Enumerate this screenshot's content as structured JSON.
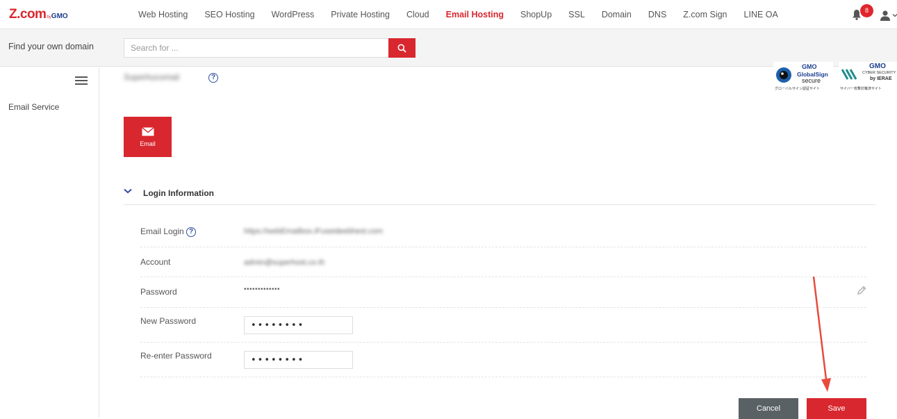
{
  "header": {
    "logo": {
      "main": "Z.com",
      "by": "by",
      "gmo": "GMO"
    },
    "nav": [
      {
        "label": "Web Hosting",
        "active": false
      },
      {
        "label": "SEO Hosting",
        "active": false
      },
      {
        "label": "WordPress",
        "active": false
      },
      {
        "label": "Private Hosting",
        "active": false
      },
      {
        "label": "Cloud",
        "active": false
      },
      {
        "label": "Email Hosting",
        "active": true
      },
      {
        "label": "ShopUp",
        "active": false
      },
      {
        "label": "SSL",
        "active": false
      },
      {
        "label": "Domain",
        "active": false
      },
      {
        "label": "DNS",
        "active": false
      },
      {
        "label": "Z.com Sign",
        "active": false
      },
      {
        "label": "LINE OA",
        "active": false
      }
    ],
    "notification_count": "8",
    "icons": {
      "bell": "bell-icon",
      "user": "user-icon",
      "caret": "chevron-down-icon"
    }
  },
  "search": {
    "find_label": "Find your own domain",
    "placeholder": "Search for ...",
    "icon": "search-icon"
  },
  "trust_badges": {
    "globalsign": {
      "brand": "GMO",
      "line1": "GlobalSign",
      "line2": "secure",
      "tiny": "グローバルサイン認証サイト"
    },
    "cyber": {
      "brand": "GMO",
      "line1": "CYBER SECURITY",
      "line2": "by IERAE",
      "tiny": "サイバー攻撃対策済サイト"
    }
  },
  "sidebar": {
    "menu_icon": "hamburger-menu-icon",
    "items": [
      {
        "label": "Email Service"
      }
    ]
  },
  "main": {
    "domain": "Superhucomail",
    "email_tile_label": "Email",
    "section_title": "Login Information",
    "fields": {
      "email_login": {
        "label": "Email Login",
        "value": "https://webEmailbox.iFuseideebhest.com"
      },
      "account": {
        "label": "Account",
        "value": "admin@superhost.co.th"
      },
      "password": {
        "label": "Password",
        "value": "•••••••••••••"
      },
      "new_password": {
        "label": "New Password",
        "value": "••••••••"
      },
      "reenter_password": {
        "label": "Re-enter Password",
        "value": "••••••••"
      }
    },
    "buttons": {
      "cancel": "Cancel",
      "save": "Save"
    }
  },
  "colors": {
    "accent": "#d8272e",
    "brand_blue": "#1a3d8f",
    "cancel": "#5a6164"
  }
}
